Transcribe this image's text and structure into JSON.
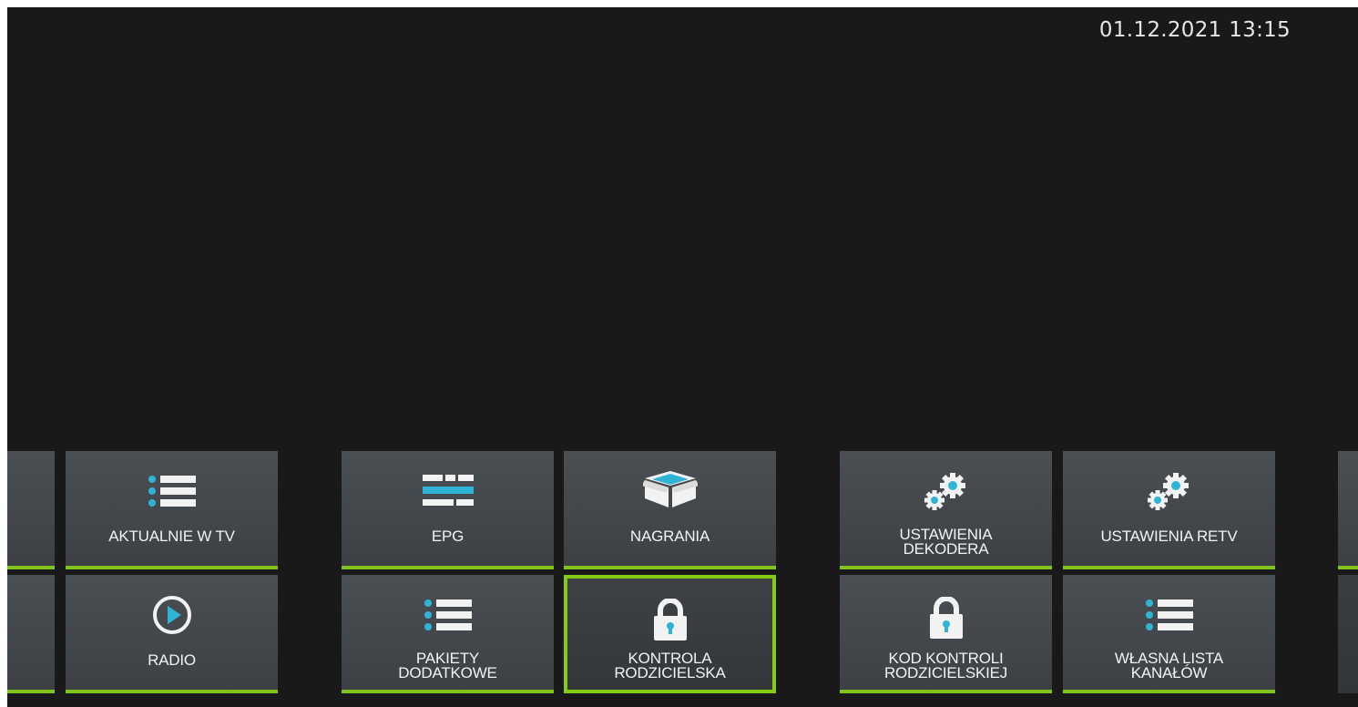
{
  "header": {
    "datetime": "01.12.2021 13:15"
  },
  "menu": {
    "accent_color": "#7fc31c",
    "icon_color": "#2fb4d6",
    "row1": [
      {
        "label": "AKTUALNIE W TV",
        "icon": "list-icon"
      },
      {
        "label": "EPG",
        "icon": "epg-icon"
      },
      {
        "label": "NAGRANIA",
        "icon": "box-icon"
      },
      {
        "label": "USTAWIENIA\nDEKODERA",
        "icon": "gears-icon"
      },
      {
        "label": "USTAWIENIA RETV",
        "icon": "gears-icon"
      }
    ],
    "row2": [
      {
        "label": "RADIO",
        "icon": "play-icon"
      },
      {
        "label": "PAKIETY\nDODATKOWE",
        "icon": "list-icon"
      },
      {
        "label": "KONTROLA\nRODZICIELSKA",
        "icon": "lock-icon",
        "selected": true
      },
      {
        "label": "KOD KONTROLI\nRODZICIELSKIEJ",
        "icon": "lock-icon"
      },
      {
        "label": "WŁASNA LISTA\nKANAŁÓW",
        "icon": "list-icon"
      }
    ]
  }
}
